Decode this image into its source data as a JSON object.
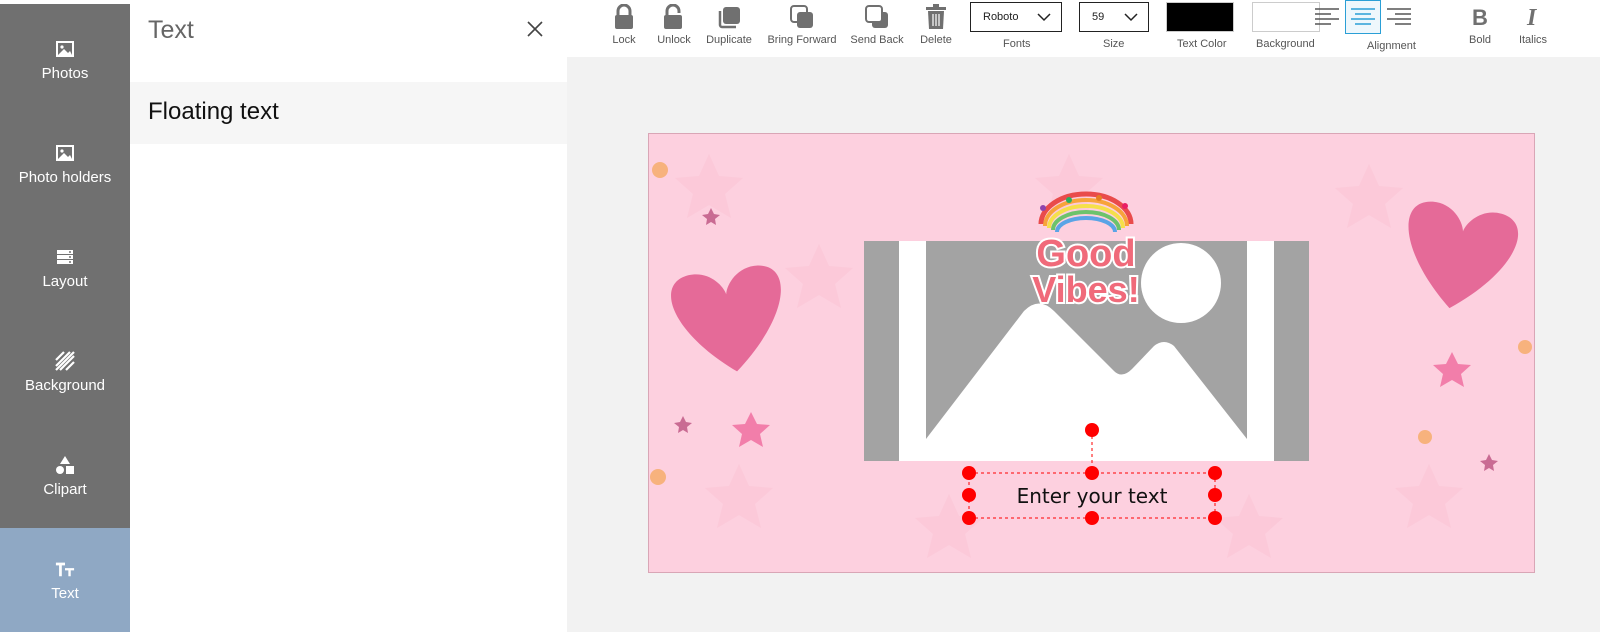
{
  "sidebar": {
    "items": [
      {
        "label": "Photos",
        "icon": "photo-icon"
      },
      {
        "label": "Photo holders",
        "icon": "photo-icon"
      },
      {
        "label": "Layout",
        "icon": "layout-icon"
      },
      {
        "label": "Background",
        "icon": "background-icon"
      },
      {
        "label": "Clipart",
        "icon": "clipart-icon"
      },
      {
        "label": "Text",
        "icon": "text-icon",
        "active": true
      }
    ]
  },
  "panel": {
    "title": "Text",
    "items": [
      "Floating text"
    ]
  },
  "toolbar": {
    "lock": "Lock",
    "unlock": "Unlock",
    "duplicate": "Duplicate",
    "bring_forward": "Bring Forward",
    "send_back": "Send Back",
    "delete": "Delete",
    "fonts_label": "Fonts",
    "font_value": "Roboto",
    "size_label": "Size",
    "size_value": "59",
    "text_color_label": "Text Color",
    "text_color": "#000000",
    "background_label": "Background",
    "background_color": "#ffffff",
    "alignment_label": "Alignment",
    "alignment_selected": "center",
    "bold_label": "Bold",
    "italics_label": "Italics"
  },
  "canvas": {
    "background_color": "#fdd0df",
    "sticker": {
      "line1": "Good",
      "line2": "Vibes!"
    },
    "text_box": {
      "text": "Enter your text",
      "handle_color": "#ff0000"
    }
  }
}
